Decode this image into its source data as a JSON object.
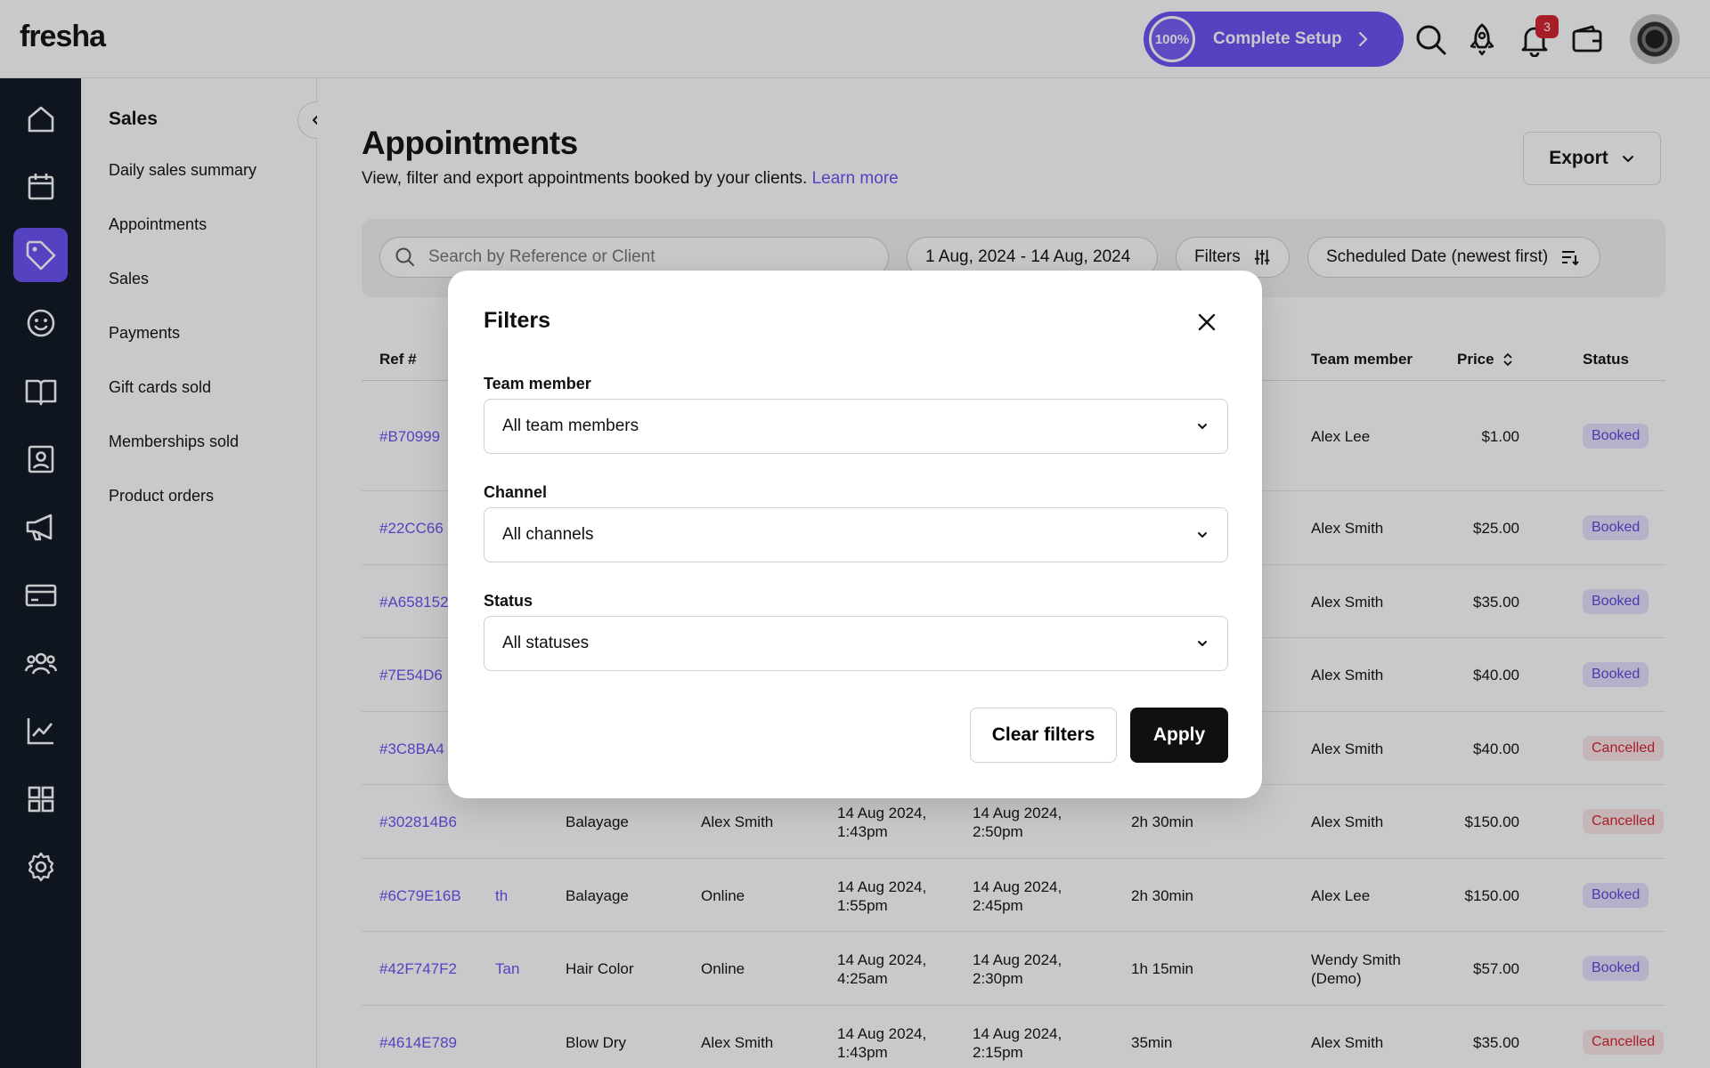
{
  "topbar": {
    "logo": "fresha",
    "setup": {
      "percent": "100%",
      "label": "Complete Setup"
    },
    "notification_count": "3",
    "icons": [
      "search-icon",
      "rocket-icon",
      "bell-icon",
      "wallet-icon"
    ]
  },
  "rail": {
    "items": [
      "home-icon",
      "calendar-icon",
      "tag-icon",
      "smiley-icon",
      "book-icon",
      "contact-card-icon",
      "megaphone-icon",
      "credit-card-icon",
      "team-icon",
      "chart-icon",
      "apps-icon",
      "gear-icon"
    ],
    "active": "tag-icon"
  },
  "subnav": {
    "title": "Sales",
    "items": [
      "Daily sales summary",
      "Appointments",
      "Sales",
      "Payments",
      "Gift cards sold",
      "Memberships sold",
      "Product orders"
    ]
  },
  "page": {
    "title": "Appointments",
    "subtitle": "View, filter and export appointments booked by your clients.",
    "learn_more": "Learn more",
    "export_label": "Export"
  },
  "toolbar": {
    "search_placeholder": "Search by Reference or Client",
    "date_range": "1 Aug, 2024 - 14 Aug, 2024",
    "filters_label": "Filters",
    "sort_label": "Scheduled Date (newest first)"
  },
  "table": {
    "headers": {
      "ref": "Ref #",
      "team_member": "Team member",
      "price": "Price",
      "status": "Status"
    },
    "rows": [
      {
        "ref": "#B70999",
        "client": "",
        "service": "",
        "channel": "",
        "created": "",
        "scheduled": "",
        "duration": "",
        "team": "Alex Lee",
        "price": "$1.00",
        "status": "Booked"
      },
      {
        "ref": "#22CC66",
        "client": "",
        "service": "",
        "channel": "",
        "created": "",
        "scheduled": "",
        "duration": "",
        "team": "Alex Smith",
        "price": "$25.00",
        "status": "Booked"
      },
      {
        "ref": "#A658152",
        "client": "",
        "service": "",
        "channel": "",
        "created": "",
        "scheduled": "",
        "duration": "",
        "team": "Alex Smith",
        "price": "$35.00",
        "status": "Booked"
      },
      {
        "ref": "#7E54D6",
        "client": "",
        "service": "",
        "channel": "",
        "created": "",
        "scheduled": "",
        "duration": "",
        "team": "Alex Smith",
        "price": "$40.00",
        "status": "Booked"
      },
      {
        "ref": "#3C8BA4",
        "client": "",
        "service": "",
        "channel": "",
        "created": "",
        "scheduled": "",
        "duration": "",
        "team": "Alex Smith",
        "price": "$40.00",
        "status": "Cancelled"
      },
      {
        "ref": "#302814B6",
        "client": "",
        "service": "Balayage",
        "channel": "Alex Smith",
        "created": "14 Aug 2024,\n1:43pm",
        "scheduled": "14 Aug 2024,\n2:50pm",
        "duration": "2h 30min",
        "team": "Alex Smith",
        "price": "$150.00",
        "status": "Cancelled"
      },
      {
        "ref": "#6C79E16B",
        "client": "th",
        "service": "Balayage",
        "channel": "Online",
        "created": "14 Aug 2024,\n1:55pm",
        "scheduled": "14 Aug 2024,\n2:45pm",
        "duration": "2h 30min",
        "team": "Alex Lee",
        "price": "$150.00",
        "status": "Booked"
      },
      {
        "ref": "#42F747F2",
        "client": "Tan",
        "service": "Hair Color",
        "channel": "Online",
        "created": "14 Aug 2024,\n4:25am",
        "scheduled": "14 Aug 2024,\n2:30pm",
        "duration": "1h 15min",
        "team": "Wendy Smith\n(Demo)",
        "price": "$57.00",
        "status": "Booked"
      },
      {
        "ref": "#4614E789",
        "client": "",
        "service": "Blow Dry",
        "channel": "Alex Smith",
        "created": "14 Aug 2024,\n1:43pm",
        "scheduled": "14 Aug 2024,\n2:15pm",
        "duration": "35min",
        "team": "Alex Smith",
        "price": "$35.00",
        "status": "Cancelled"
      }
    ]
  },
  "modal": {
    "title": "Filters",
    "fields": [
      {
        "label": "Team member",
        "value": "All team members"
      },
      {
        "label": "Channel",
        "value": "All channels"
      },
      {
        "label": "Status",
        "value": "All statuses"
      }
    ],
    "clear_label": "Clear filters",
    "apply_label": "Apply"
  },
  "colors": {
    "accent": "#6950f3",
    "rail": "#0d1620",
    "booked_bg": "#e5e1fd",
    "cancelled_bg": "#fde6e6"
  }
}
